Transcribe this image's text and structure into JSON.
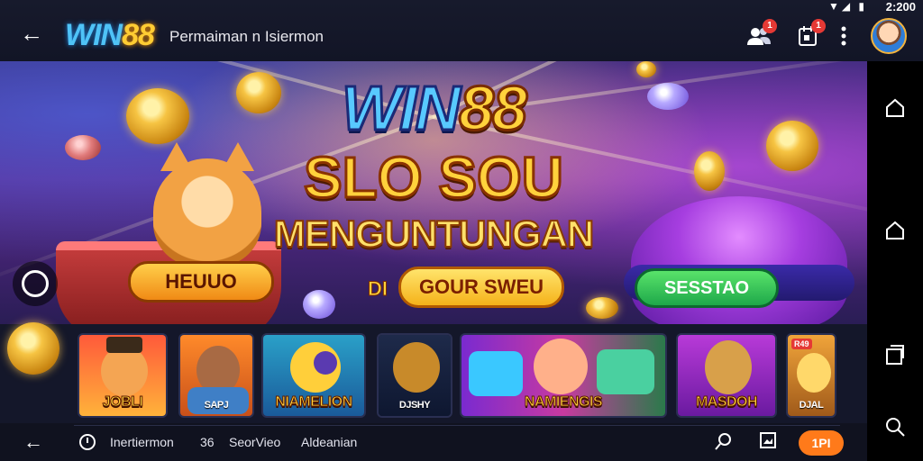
{
  "status_bar": {
    "time": "2:200",
    "icons_text": "▼◢ ▮"
  },
  "header": {
    "logo_part1": "WIN",
    "logo_part2": "88",
    "subtitle": "Permaiman n Isiermon",
    "notification_badge": "1",
    "calendar_badge": "1"
  },
  "banner": {
    "title_part1": "WIN",
    "title_part2": "88",
    "line2": "SLO SOU",
    "line3": "MENGUNTUNGAN",
    "di_text": "DI",
    "button_center": "GOUR SWEU",
    "button_left": "HEUUO",
    "button_right": "SESSTAO"
  },
  "games": [
    {
      "name": "JOBLI",
      "tag": ""
    },
    {
      "name": "SAPJ",
      "tag": ""
    },
    {
      "name": "NIAMELION",
      "tag": ""
    },
    {
      "name": "DJSHY",
      "tag": ""
    },
    {
      "name": "NAMIENGIS",
      "tag": ""
    },
    {
      "name": "MASDOH",
      "tag": ""
    },
    {
      "name": "DJAL",
      "tag": "R49"
    }
  ],
  "bottom_bar": {
    "item1": "Inertiermon",
    "item2": "36",
    "item3": "SeorVieo",
    "item4": "Aldeanian",
    "pill": "1PI"
  },
  "colors": {
    "accent_orange": "#ff7a1a",
    "accent_gold": "#ffd23c",
    "accent_blue": "#58c9ff",
    "badge_red": "#e53935"
  }
}
